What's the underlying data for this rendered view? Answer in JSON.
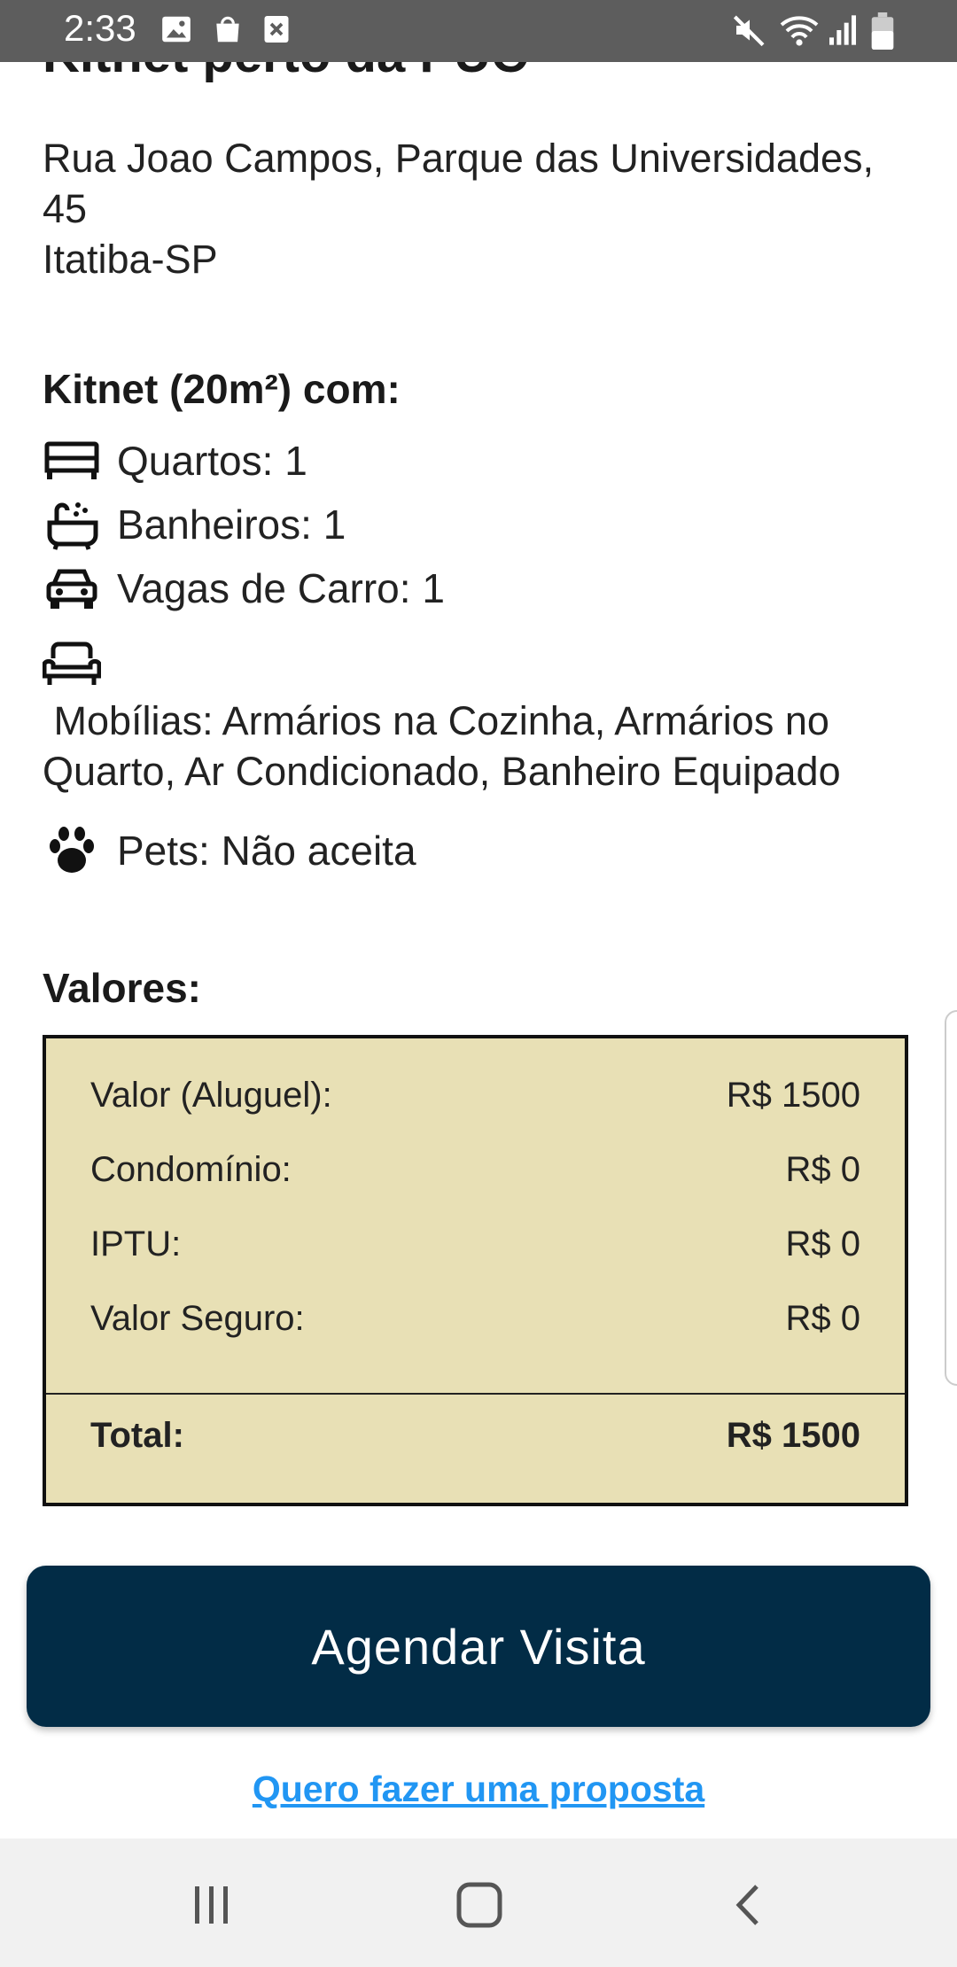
{
  "status_bar": {
    "time": "2:33",
    "left_icons": [
      "image-icon",
      "shopping-bag-icon",
      "close-box-icon"
    ],
    "right_icons": [
      "mute-icon",
      "wifi-icon",
      "signal-icon",
      "battery-icon"
    ]
  },
  "listing": {
    "title_partial": "Kitnet perto da PUC",
    "address_lines": [
      "Rua Joao Campos, Parque das Universidades,",
      "45",
      "Itatiba-SP"
    ],
    "features_heading": "Kitnet (20m²) com:",
    "features": {
      "rooms": "Quartos: 1",
      "bathrooms": "Banheiros: 1",
      "parking": "Vagas de Carro: 1",
      "furniture_lines": [
        " Mobílias: Armários na Cozinha, Armários no",
        "Quarto, Ar Condicionado, Banheiro Equipado"
      ],
      "pets": "Pets: Não aceita"
    },
    "feature_icons": [
      "bed-icon",
      "bathtub-icon",
      "car-icon",
      "sofa-icon",
      "paw-icon"
    ]
  },
  "values": {
    "heading": "Valores:",
    "rows": [
      {
        "label": "Valor (Aluguel):",
        "value": "R$ 1500"
      },
      {
        "label": "Condomínio:",
        "value": "R$ 0"
      },
      {
        "label": "IPTU:",
        "value": "R$ 0"
      },
      {
        "label": "Valor Seguro:",
        "value": "R$ 0"
      }
    ],
    "total_label": "Total:",
    "total_value": "R$ 1500"
  },
  "actions": {
    "schedule_visit": "Agendar Visita",
    "make_proposal": "Quero fazer uma proposta"
  },
  "colors": {
    "status_bar": "#5d5d5d",
    "values_box_bg": "#e8e0b5",
    "cta_bg": "#022c46",
    "link": "#2196f3",
    "nav_bar": "#f1f1f1"
  },
  "nav_icons": [
    "recent-apps-icon",
    "home-icon",
    "back-icon"
  ]
}
